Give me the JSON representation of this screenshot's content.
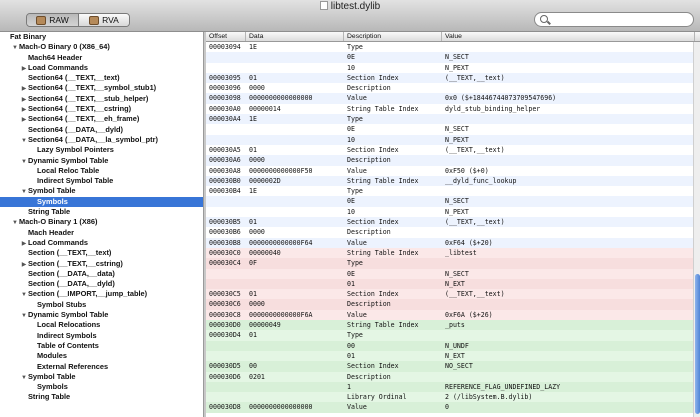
{
  "window": {
    "title": "libtest.dylib"
  },
  "toolbar": {
    "segments": [
      {
        "label": "RAW",
        "active": true
      },
      {
        "label": "RVA",
        "active": false
      }
    ],
    "search_placeholder": ""
  },
  "sidebar": {
    "items": [
      {
        "label": "Fat Binary",
        "indent": 0,
        "toggle": "",
        "selected": false
      },
      {
        "label": "Mach-O Binary 0 (X86_64)",
        "indent": 1,
        "toggle": "▼",
        "selected": false
      },
      {
        "label": "Mach64 Header",
        "indent": 2,
        "toggle": "",
        "selected": false
      },
      {
        "label": "Load Commands",
        "indent": 2,
        "toggle": "▶",
        "selected": false
      },
      {
        "label": "Section64 (__TEXT,__text)",
        "indent": 2,
        "toggle": "",
        "selected": false
      },
      {
        "label": "Section64 (__TEXT,__symbol_stub1)",
        "indent": 2,
        "toggle": "▶",
        "selected": false
      },
      {
        "label": "Section64 (__TEXT,__stub_helper)",
        "indent": 2,
        "toggle": "▶",
        "selected": false
      },
      {
        "label": "Section64 (__TEXT,__cstring)",
        "indent": 2,
        "toggle": "▶",
        "selected": false
      },
      {
        "label": "Section64 (__TEXT,__eh_frame)",
        "indent": 2,
        "toggle": "▶",
        "selected": false
      },
      {
        "label": "Section64 (__DATA,__dyld)",
        "indent": 2,
        "toggle": "",
        "selected": false
      },
      {
        "label": "Section64 (__DATA,__la_symbol_ptr)",
        "indent": 2,
        "toggle": "▼",
        "selected": false
      },
      {
        "label": "Lazy Symbol Pointers",
        "indent": 3,
        "toggle": "",
        "selected": false
      },
      {
        "label": "Dynamic Symbol Table",
        "indent": 2,
        "toggle": "▼",
        "selected": false
      },
      {
        "label": "Local Reloc Table",
        "indent": 3,
        "toggle": "",
        "selected": false
      },
      {
        "label": "Indirect Symbol Table",
        "indent": 3,
        "toggle": "",
        "selected": false
      },
      {
        "label": "Symbol Table",
        "indent": 2,
        "toggle": "▼",
        "selected": false
      },
      {
        "label": "Symbols",
        "indent": 3,
        "toggle": "",
        "selected": true
      },
      {
        "label": "String Table",
        "indent": 2,
        "toggle": "",
        "selected": false
      },
      {
        "label": "Mach-O Binary 1 (X86)",
        "indent": 1,
        "toggle": "▼",
        "selected": false
      },
      {
        "label": "Mach Header",
        "indent": 2,
        "toggle": "",
        "selected": false
      },
      {
        "label": "Load Commands",
        "indent": 2,
        "toggle": "▶",
        "selected": false
      },
      {
        "label": "Section (__TEXT,__text)",
        "indent": 2,
        "toggle": "",
        "selected": false
      },
      {
        "label": "Section (__TEXT,__cstring)",
        "indent": 2,
        "toggle": "▶",
        "selected": false
      },
      {
        "label": "Section (__DATA,__data)",
        "indent": 2,
        "toggle": "",
        "selected": false
      },
      {
        "label": "Section (__DATA,__dyld)",
        "indent": 2,
        "toggle": "",
        "selected": false
      },
      {
        "label": "Section (__IMPORT,__jump_table)",
        "indent": 2,
        "toggle": "▼",
        "selected": false
      },
      {
        "label": "Symbol Stubs",
        "indent": 3,
        "toggle": "",
        "selected": false
      },
      {
        "label": "Dynamic Symbol Table",
        "indent": 2,
        "toggle": "▼",
        "selected": false
      },
      {
        "label": "Local Relocations",
        "indent": 3,
        "toggle": "",
        "selected": false
      },
      {
        "label": "Indirect Symbols",
        "indent": 3,
        "toggle": "",
        "selected": false
      },
      {
        "label": "Table of Contents",
        "indent": 3,
        "toggle": "",
        "selected": false
      },
      {
        "label": "Modules",
        "indent": 3,
        "toggle": "",
        "selected": false
      },
      {
        "label": "External References",
        "indent": 3,
        "toggle": "",
        "selected": false
      },
      {
        "label": "Symbol Table",
        "indent": 2,
        "toggle": "▼",
        "selected": false
      },
      {
        "label": "Symbols",
        "indent": 3,
        "toggle": "",
        "selected": false
      },
      {
        "label": "String Table",
        "indent": 2,
        "toggle": "",
        "selected": false
      }
    ]
  },
  "table": {
    "columns": [
      "Offset",
      "Data",
      "Description",
      "Value"
    ],
    "rows": [
      {
        "offset": "00003094",
        "data": "1E",
        "desc": "Type",
        "value": "",
        "group": "blue"
      },
      {
        "offset": "",
        "data": "",
        "desc": "0E",
        "value": "N_SECT",
        "group": "blue"
      },
      {
        "offset": "",
        "data": "",
        "desc": "10",
        "value": "N_PEXT",
        "group": "blue"
      },
      {
        "offset": "00003095",
        "data": "01",
        "desc": "Section Index",
        "value": "(__TEXT,__text)",
        "group": "blue"
      },
      {
        "offset": "00003096",
        "data": "0000",
        "desc": "Description",
        "value": "",
        "group": "blue"
      },
      {
        "offset": "00003098",
        "data": "0000000000000000",
        "desc": "Value",
        "value": "0x0 ($+18446744073709547696)",
        "group": "blue"
      },
      {
        "offset": "000030A0",
        "data": "00000014",
        "desc": "String Table Index",
        "value": "dyld_stub_binding_helper",
        "group": "blue"
      },
      {
        "offset": "000030A4",
        "data": "1E",
        "desc": "Type",
        "value": "",
        "group": "blue"
      },
      {
        "offset": "",
        "data": "",
        "desc": "0E",
        "value": "N_SECT",
        "group": "blue"
      },
      {
        "offset": "",
        "data": "",
        "desc": "10",
        "value": "N_PEXT",
        "group": "blue"
      },
      {
        "offset": "000030A5",
        "data": "01",
        "desc": "Section Index",
        "value": "(__TEXT,__text)",
        "group": "blue"
      },
      {
        "offset": "000030A6",
        "data": "0000",
        "desc": "Description",
        "value": "",
        "group": "blue"
      },
      {
        "offset": "000030A8",
        "data": "0000000000000F50",
        "desc": "Value",
        "value": "0xF50 ($+0)",
        "group": "blue"
      },
      {
        "offset": "000030B0",
        "data": "0000002D",
        "desc": "String Table Index",
        "value": "__dyld_func_lookup",
        "group": "blue"
      },
      {
        "offset": "000030B4",
        "data": "1E",
        "desc": "Type",
        "value": "",
        "group": "blue"
      },
      {
        "offset": "",
        "data": "",
        "desc": "0E",
        "value": "N_SECT",
        "group": "blue"
      },
      {
        "offset": "",
        "data": "",
        "desc": "10",
        "value": "N_PEXT",
        "group": "blue"
      },
      {
        "offset": "000030B5",
        "data": "01",
        "desc": "Section Index",
        "value": "(__TEXT,__text)",
        "group": "blue"
      },
      {
        "offset": "000030B6",
        "data": "0000",
        "desc": "Description",
        "value": "",
        "group": "blue"
      },
      {
        "offset": "000030B8",
        "data": "0000000000000F64",
        "desc": "Value",
        "value": "0xF64 ($+20)",
        "group": "blue"
      },
      {
        "offset": "000030C0",
        "data": "00000040",
        "desc": "String Table Index",
        "value": "_libtest",
        "group": "red"
      },
      {
        "offset": "000030C4",
        "data": "0F",
        "desc": "Type",
        "value": "",
        "group": "red"
      },
      {
        "offset": "",
        "data": "",
        "desc": "0E",
        "value": "N_SECT",
        "group": "red"
      },
      {
        "offset": "",
        "data": "",
        "desc": "01",
        "value": "N_EXT",
        "group": "red"
      },
      {
        "offset": "000030C5",
        "data": "01",
        "desc": "Section Index",
        "value": "(__TEXT,__text)",
        "group": "red"
      },
      {
        "offset": "000030C6",
        "data": "0000",
        "desc": "Description",
        "value": "",
        "group": "red"
      },
      {
        "offset": "000030C8",
        "data": "0000000000000F6A",
        "desc": "Value",
        "value": "0xF6A ($+26)",
        "group": "red"
      },
      {
        "offset": "000030D0",
        "data": "00000049",
        "desc": "String Table Index",
        "value": "_puts",
        "group": "green"
      },
      {
        "offset": "000030D4",
        "data": "01",
        "desc": "Type",
        "value": "",
        "group": "green"
      },
      {
        "offset": "",
        "data": "",
        "desc": "00",
        "value": "N_UNDF",
        "group": "green"
      },
      {
        "offset": "",
        "data": "",
        "desc": "01",
        "value": "N_EXT",
        "group": "green"
      },
      {
        "offset": "000030D5",
        "data": "00",
        "desc": "Section Index",
        "value": "NO_SECT",
        "group": "green"
      },
      {
        "offset": "000030D6",
        "data": "0201",
        "desc": "Description",
        "value": "",
        "group": "green"
      },
      {
        "offset": "",
        "data": "",
        "desc": "1",
        "value": "REFERENCE_FLAG_UNDEFINED_LAZY",
        "group": "green"
      },
      {
        "offset": "",
        "data": "",
        "desc": "Library Ordinal",
        "value": "2 (/libSystem.B.dylib)",
        "group": "green"
      },
      {
        "offset": "000030D8",
        "data": "0000000000000000",
        "desc": "Value",
        "value": "0",
        "group": "green"
      }
    ]
  },
  "colors": {
    "selection": "#3875d7",
    "row_blue_alt": "#edf3fe",
    "row_red": "#fbe8e8",
    "row_green": "#e4f6e4"
  }
}
